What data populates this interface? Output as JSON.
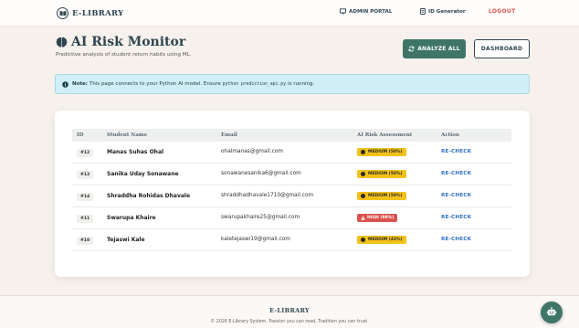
{
  "navbar": {
    "brand": "E-LIBRARY",
    "admin_portal": "ADMIN PORTAL",
    "id_generator": "ID Generator",
    "logout": "LOGOUT"
  },
  "header": {
    "title": "AI Risk Monitor",
    "subtitle": "Predictive analysis of student return habits using ML.",
    "analyze_all": "ANALYZE ALL",
    "dashboard": "DASHBOARD"
  },
  "note": {
    "label": "Note:",
    "text_before": "This page connects to your Python AI model. Ensure",
    "code": "python prediction_api.py",
    "text_after": "is running."
  },
  "table": {
    "columns": {
      "id": "ID",
      "name": "Student Name",
      "email": "Email",
      "risk": "AI Risk Assessment",
      "action": "Action"
    },
    "rows": [
      {
        "id": "#12",
        "name": "Manas Suhas Ohal",
        "email": "ohalmanas@gmail.com",
        "risk": "MEDIUM (50%)",
        "level": "medium",
        "action": "RE-CHECK"
      },
      {
        "id": "#13",
        "name": "Sanika Uday Sonawane",
        "email": "sonawanesanika6@gmail.com",
        "risk": "MEDIUM (50%)",
        "level": "medium",
        "action": "RE-CHECK"
      },
      {
        "id": "#14",
        "name": "Shraddha Rohidas Dhavale",
        "email": "shraddhadhavale1710@gmail.com",
        "risk": "MEDIUM (50%)",
        "level": "medium",
        "action": "RE-CHECK"
      },
      {
        "id": "#11",
        "name": "Swarupa Khaire",
        "email": "swarupakhaire25@gmail.com",
        "risk": "HIGH (99%)",
        "level": "high",
        "action": "RE-CHECK"
      },
      {
        "id": "#10",
        "name": "Tejaswi Kale",
        "email": "kaletejaswi19@gmail.com",
        "risk": "MEDIUM (43%)",
        "level": "medium",
        "action": "RE-CHECK"
      }
    ]
  },
  "footer": {
    "title": "E-LIBRARY",
    "copyright": "© 2026 E-Library System. Passion you can read, Tradition you can trust."
  },
  "colors": {
    "primary": "#2f4550",
    "accent_green": "#3e7567",
    "danger": "#d9534f",
    "warning": "#f2c21a",
    "link": "#2e6fc2",
    "info_bg": "#cfeef5"
  },
  "icons": {
    "brand": "book-icon",
    "admin": "monitor-icon",
    "id_generator": "id-card-icon",
    "title": "brain-icon",
    "analyze": "refresh-icon",
    "note": "info-icon",
    "chatbot": "robot-icon"
  }
}
